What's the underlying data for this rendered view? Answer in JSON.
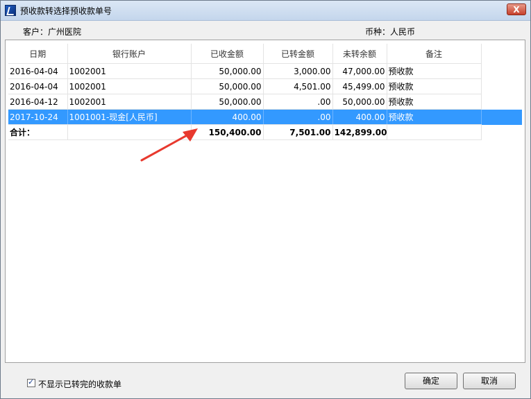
{
  "window": {
    "title": "预收款转选择预收款单号",
    "close_label": "X"
  },
  "info": {
    "customer": "客户：广州医院",
    "currency": "币种：人民币"
  },
  "table": {
    "columns": [
      "日期",
      "银行账户",
      "已收金额",
      "已转金额",
      "未转余额",
      "备注"
    ],
    "rows": [
      {
        "date": "2016-04-04",
        "account": "1002001",
        "received": "50,000.00",
        "transferred": "3,000.00",
        "remaining": "47,000.00",
        "note": "预收款"
      },
      {
        "date": "2016-04-04",
        "account": "1002001",
        "received": "50,000.00",
        "transferred": "4,501.00",
        "remaining": "45,499.00",
        "note": "预收款"
      },
      {
        "date": "2016-04-12",
        "account": "1002001",
        "received": "50,000.00",
        "transferred": ".00",
        "remaining": "50,000.00",
        "note": "预收款"
      },
      {
        "date": "2017-10-24",
        "account": "1001001-现金[人民币]",
        "received": "400.00",
        "transferred": ".00",
        "remaining": "400.00",
        "note": "预收款"
      }
    ],
    "selected_row": 3,
    "total": {
      "label": "合计：",
      "received": "150,400.00",
      "transferred": "7,501.00",
      "remaining": "142,899.00"
    }
  },
  "footer": {
    "hide_transferred_label": "不显示已转完的收款单",
    "hide_transferred_checked": true,
    "ok_label": "确定",
    "cancel_label": "取消"
  },
  "colors": {
    "selection": "#3399ff",
    "arrow": "#e8392e"
  }
}
